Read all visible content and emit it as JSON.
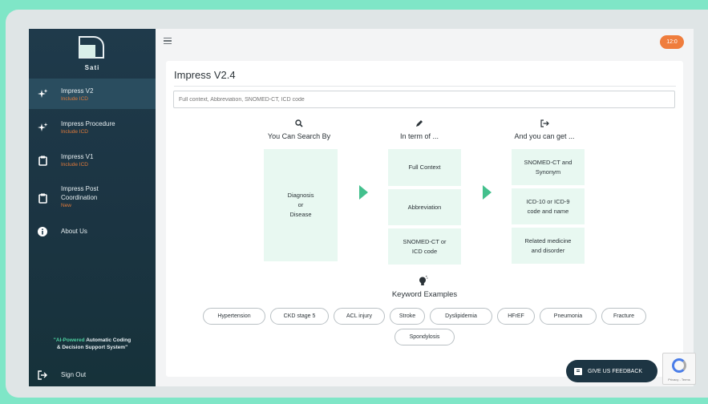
{
  "sidebar": {
    "brand": "Sati",
    "items": [
      {
        "label": "Impress V2",
        "sub": "Include ICD",
        "icon": "sparkle-icon"
      },
      {
        "label": "Impress Procedure",
        "sub": "Include ICD",
        "icon": "sparkle-icon"
      },
      {
        "label": "Impress V1",
        "sub": "Include ICD",
        "icon": "clipboard-icon"
      },
      {
        "label": "Impress Post",
        "label2": "Coordination",
        "sub": "New",
        "icon": "clipboard-icon"
      },
      {
        "label": "About Us",
        "icon": "info-icon"
      }
    ],
    "tagline_highlight": "\"AI-Powered",
    "tagline_rest": " Automatic Coding",
    "tagline_line2": "& Decision Support System\"",
    "signout": "Sign Out"
  },
  "topbar": {
    "avatar": "12:0"
  },
  "main": {
    "title": "Impress V2.4",
    "search_placeholder": "Full context, Abbreviation, SNOMED-CT, ICD code",
    "columns": [
      {
        "title": "You Can Search By",
        "icon": "search-icon"
      },
      {
        "title": "In term of ...",
        "icon": "pencil-icon"
      },
      {
        "title": "And you can get ...",
        "icon": "sign-out-icon"
      }
    ],
    "search_box": {
      "l1": "Diagnosis",
      "l2": "or",
      "l3": "Disease"
    },
    "term_boxes": [
      {
        "l1": "Full Context"
      },
      {
        "l1": "Abbreviation"
      },
      {
        "l1": "SNOMED-CT or",
        "l2": "ICD code"
      }
    ],
    "get_boxes": [
      {
        "l1": "SNOMED-CT and",
        "l2": "Synonym"
      },
      {
        "l1": "ICD-10 or ICD-9",
        "l2": "code and name"
      },
      {
        "l1": "Related medicine",
        "l2": "and disorder"
      }
    ],
    "keyword_title": "Keyword Examples",
    "keywords": [
      "Hypertension",
      "CKD stage 5",
      "ACL injury",
      "Stroke",
      "Dyslipidemia",
      "HFrEF",
      "Pneumonia",
      "Fracture",
      "Spondylosis"
    ]
  },
  "feedback_label": "GIVE US FEEDBACK",
  "recaptcha_text": "Privacy - Terms",
  "colors": {
    "accent": "#43c08d",
    "sidebar": "#1f3a4b",
    "box_bg": "#e8f8f1",
    "subtext": "#e07a3a",
    "background": "#7fe6c7"
  }
}
